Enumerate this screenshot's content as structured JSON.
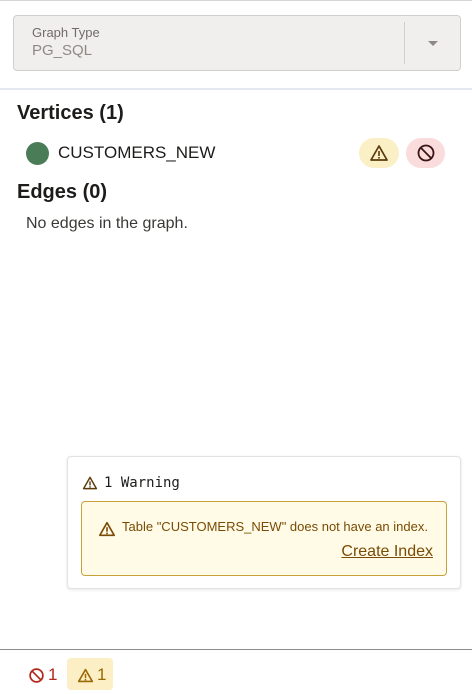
{
  "graph_type": {
    "label": "Graph Type",
    "value": "PG_SQL",
    "icon": "chevron-down-icon"
  },
  "vertices": {
    "title": "Vertices (1)",
    "items": [
      {
        "name": "CUSTOMERS_NEW",
        "color": "#4a7d57"
      }
    ]
  },
  "edges": {
    "title": "Edges (0)",
    "empty_text": "No edges in the graph."
  },
  "warnings_panel": {
    "header": "1 Warning",
    "message": "Table \"CUSTOMERS_NEW\" does not have an index.",
    "action_label": "Create Index"
  },
  "status_bar": {
    "error_count": "1",
    "warning_count": "1"
  },
  "colors": {
    "warning": "#9a6a06",
    "error": "#b3261e",
    "vertex": "#4a7d57"
  }
}
